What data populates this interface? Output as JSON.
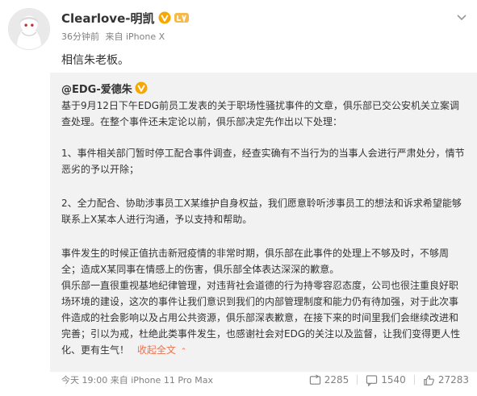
{
  "post": {
    "author": "Clearlove-明凯",
    "time": "36分钟前",
    "source": "来自 iPhone X",
    "text": "相信朱老板。"
  },
  "repost": {
    "author": "@EDG-爱德朱",
    "paragraphs": [
      "基于9月12日下午EDG前员工发表的关于职场性骚扰事件的文章，俱乐部已交公安机关立案调",
      "查处理。在整个事件还未定论以前，俱乐部决定先作出以下处理：",
      "1、事件相关部门暂时停工配合事件调查，经查实确有不当行为的当事人会进行严肃处分，情节",
      "恶劣的予以开除；",
      "2、全力配合、协助涉事员工X某维护自身权益，我们愿意聆听涉事员工的想法和诉求希望能够",
      "联系上X某本人进行沟通，予以支持和帮助。",
      "事件发生的时候正值抗击新冠疫情的非常时期，俱乐部在此事件的处理上不够及时，不够周",
      "全；造成X某同事在情感上的伤害，俱乐部全体表达深深的歉意。",
      "俱乐部一直很重视基地纪律管理，对违背社会道德的行为持零容忍态度，公司也很注重良好职",
      "场环境的建设，这次的事件让我们意识到我们的内部管理制度和能力仍有待加强，对于此次事",
      "件造成的社会影响以及占用公共资源，俱乐部深表歉意，在接下来的时间里我们会继续改进和",
      "完善；引以为戒，杜绝此类事件发生，也感谢社会对EDG的关注以及监督，让我们变得更人性",
      "化、更有生气！"
    ],
    "collapse_label": "收起全文",
    "collapse_arrow": "⌃",
    "time": "今天 19:00",
    "source": "来自 iPhone 11 Pro Max",
    "reposts": "2285",
    "comments": "1540",
    "likes": "27283"
  },
  "colors": {
    "accent": "#eb7350",
    "vip": "#f6a800",
    "repost_bg": "#f2f2f2",
    "meta": "#808080"
  },
  "icons": {
    "vip": "yellow-v-verified-icon",
    "level": "level-badge-icon",
    "chevron": "chevron-down-icon",
    "repost": "repost-icon",
    "comment": "comment-icon",
    "like": "thumbs-up-icon"
  }
}
